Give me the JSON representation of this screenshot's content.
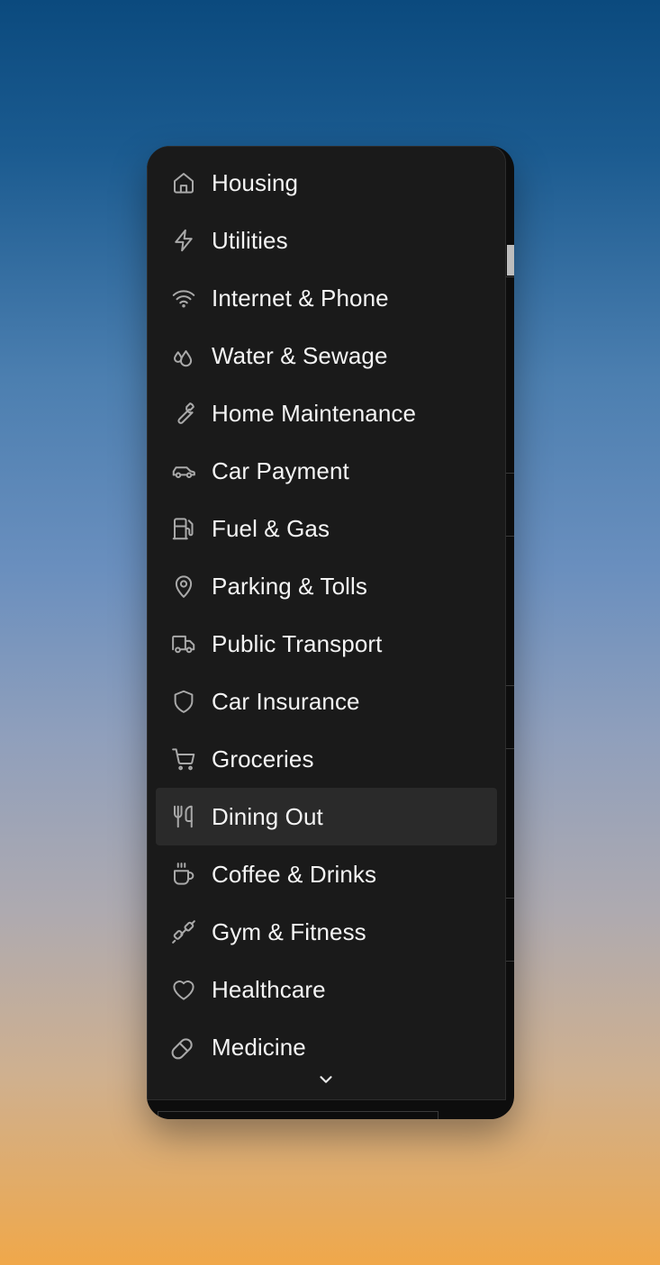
{
  "menu": {
    "items": [
      {
        "label": "Housing",
        "icon": "house-icon"
      },
      {
        "label": "Utilities",
        "icon": "lightning-icon"
      },
      {
        "label": "Internet & Phone",
        "icon": "wifi-icon"
      },
      {
        "label": "Water & Sewage",
        "icon": "droplets-icon"
      },
      {
        "label": "Home Maintenance",
        "icon": "wrench-icon"
      },
      {
        "label": "Car Payment",
        "icon": "car-icon"
      },
      {
        "label": "Fuel & Gas",
        "icon": "fuel-pump-icon"
      },
      {
        "label": "Parking & Tolls",
        "icon": "map-pin-icon"
      },
      {
        "label": "Public Transport",
        "icon": "truck-icon"
      },
      {
        "label": "Car Insurance",
        "icon": "shield-icon"
      },
      {
        "label": "Groceries",
        "icon": "shopping-cart-icon"
      },
      {
        "label": "Dining Out",
        "icon": "utensils-icon",
        "highlighted": true
      },
      {
        "label": "Coffee & Drinks",
        "icon": "coffee-cup-icon"
      },
      {
        "label": "Gym & Fitness",
        "icon": "dumbbell-icon"
      },
      {
        "label": "Healthcare",
        "icon": "heart-icon"
      },
      {
        "label": "Medicine",
        "icon": "pill-icon"
      }
    ],
    "scroll_indicator_icon": "chevron-down-icon"
  },
  "colors": {
    "menu_background": "#1a1a1a",
    "highlight_background": "#2a2a2a",
    "label_color": "#f4f4f4",
    "icon_color": "#a9a9a9"
  }
}
